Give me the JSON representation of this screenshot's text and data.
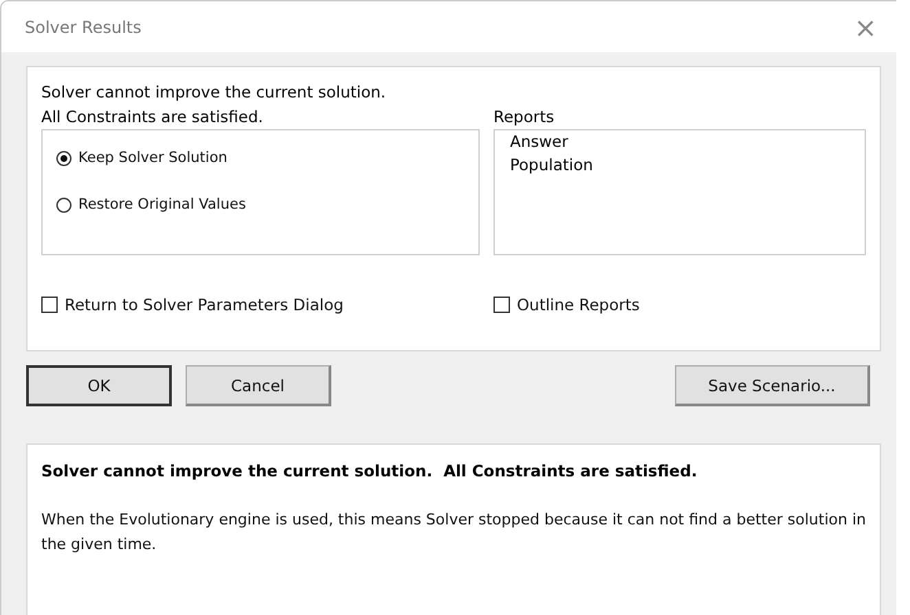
{
  "window": {
    "title": "Solver Results",
    "close": "×"
  },
  "message": "Solver cannot improve the current solution.  All Constraints are satisfied.",
  "options": [
    {
      "label": "Keep Solver Solution",
      "selected": true
    },
    {
      "label": "Restore Original Values",
      "selected": false
    }
  ],
  "reports": {
    "label": "Reports",
    "items": [
      {
        "label": "Answer",
        "selected": false
      },
      {
        "label": "Population",
        "selected": false
      }
    ]
  },
  "checkboxes": [
    {
      "label": "Return to Solver Parameters Dialog",
      "checked": false
    },
    {
      "label": "Outline Reports",
      "checked": false
    }
  ],
  "buttons": [
    {
      "label": "OK",
      "default": true
    },
    {
      "label": "Cancel",
      "default": false
    }
  ],
  "save_button": "Save Scenario...",
  "details": {
    "heading": "Solver cannot improve the current solution.  All Constraints are satisfied.",
    "text": "When the Evolutionary engine is used, this means Solver stopped because it can not find a better solution in the given time."
  }
}
